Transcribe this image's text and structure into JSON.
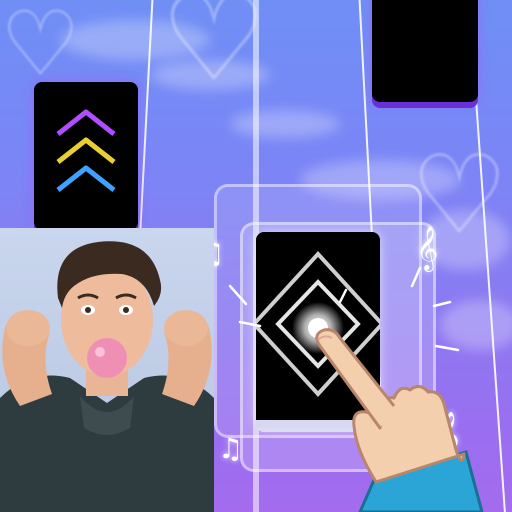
{
  "game": {
    "tiles": [
      {
        "name": "tile-top-right",
        "kind": "tap"
      },
      {
        "name": "tile-arrows",
        "kind": "swipe-up",
        "arrow_colors": [
          "#b24dff",
          "#e8d034",
          "#3fa2ff"
        ]
      },
      {
        "name": "tile-hold",
        "kind": "hold",
        "glow_color": "#ffffff"
      }
    ],
    "decorations": {
      "note_icons": [
        "music-note-icon",
        "music-note-icon",
        "treble-clef-icon",
        "treble-clef-icon"
      ],
      "cloud_color": "#ffffff",
      "background_top": "#6f8ff5",
      "background_bottom": "#a46bee"
    },
    "avatar": {
      "shirt_color": "#2e3b3f"
    },
    "hand": {
      "skin_color": "#f4cfae",
      "sleeve_color": "#2aa5d6"
    }
  }
}
